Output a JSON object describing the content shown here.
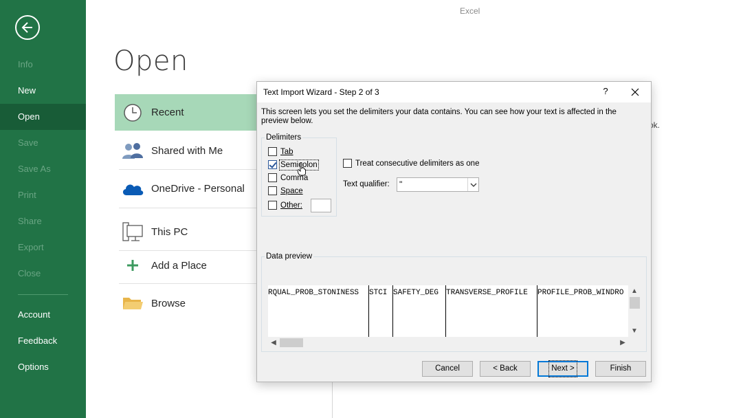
{
  "app": {
    "title": "Excel"
  },
  "sidebar": {
    "back_icon": "back-arrow-icon",
    "items": [
      {
        "label": "Info",
        "state": "disabled"
      },
      {
        "label": "New",
        "state": "enabled"
      },
      {
        "label": "Open",
        "state": "active"
      },
      {
        "label": "Save",
        "state": "disabled"
      },
      {
        "label": "Save As",
        "state": "disabled"
      },
      {
        "label": "Print",
        "state": "disabled"
      },
      {
        "label": "Share",
        "state": "disabled"
      },
      {
        "label": "Export",
        "state": "disabled"
      },
      {
        "label": "Close",
        "state": "disabled"
      },
      {
        "label": "Account",
        "state": "enabled"
      },
      {
        "label": "Feedback",
        "state": "enabled"
      },
      {
        "label": "Options",
        "state": "enabled"
      }
    ],
    "colors": {
      "background": "#217346",
      "active": "#185c37"
    }
  },
  "main": {
    "title": "Open",
    "locations": [
      {
        "label": "Recent",
        "icon": "clock-icon",
        "selected": true
      },
      {
        "label": "Shared with Me",
        "icon": "people-icon",
        "selected": false
      },
      {
        "label": "OneDrive - Personal",
        "icon": "cloud-icon",
        "selected": false
      },
      {
        "label": "This PC",
        "icon": "computer-icon",
        "selected": false
      },
      {
        "label": "Add a Place",
        "icon": "plus-icon",
        "selected": false
      },
      {
        "label": "Browse",
        "icon": "folder-icon",
        "selected": false
      }
    ],
    "obscured_text": "ok."
  },
  "dialog": {
    "title": "Text Import Wizard - Step 2 of 3",
    "help": "?",
    "intro": "This screen lets you set the delimiters your data contains.  You can see how your text is affected in the preview below.",
    "delimiters_legend": "Delimiters",
    "delimiters": [
      {
        "label": "Tab",
        "checked": false
      },
      {
        "label": "Semicolon",
        "checked": true
      },
      {
        "label": "Comma",
        "checked": false
      },
      {
        "label": "Space",
        "checked": false
      },
      {
        "label": "Other:",
        "checked": false
      }
    ],
    "other_value": "",
    "consecutive_label": "Treat consecutive delimiters as one",
    "consecutive_checked": false,
    "qualifier_label": "Text qualifier:",
    "qualifier_value": "\"",
    "preview_legend": "Data preview",
    "preview_columns": [
      "RQUAL_PROB_STONINESS",
      "STCI",
      "SAFETY_DEG",
      "TRANSVERSE_PROFILE",
      "PROFILE_PROB_WINDRO"
    ],
    "buttons": {
      "cancel": "Cancel",
      "back": "< Back",
      "next": "Next >",
      "finish": "Finish"
    }
  }
}
